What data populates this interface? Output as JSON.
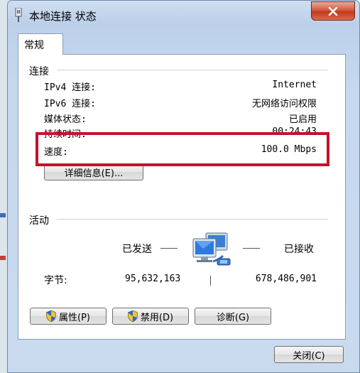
{
  "window": {
    "title": "本地连接 状态"
  },
  "tabs": [
    {
      "label": "常规"
    }
  ],
  "connection": {
    "group_label": "连接",
    "rows": [
      {
        "label": "IPv4 连接:",
        "value": "Internet"
      },
      {
        "label": "IPv6 连接:",
        "value": "无网络访问权限"
      },
      {
        "label": "媒体状态:",
        "value": "已启用"
      },
      {
        "label": "持续时间:",
        "value": "00:24:43"
      },
      {
        "label": "速度:",
        "value": "100.0 Mbps"
      }
    ],
    "details_button": "详细信息(E)..."
  },
  "activity": {
    "group_label": "活动",
    "sent_label": "已发送",
    "received_label": "已接收",
    "bytes_label": "字节:",
    "bytes_sent": "95,632,163",
    "bytes_received": "678,486,901"
  },
  "buttons": {
    "properties": "属性(P)",
    "disable": "禁用(D)",
    "diagnose": "诊断(G)",
    "close": "关闭(C)"
  },
  "colors": {
    "highlight": "#c8102e",
    "close_button": "#c23a1e"
  }
}
